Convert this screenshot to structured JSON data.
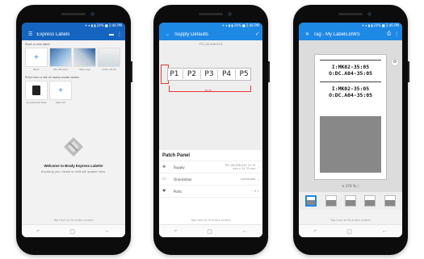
{
  "phones": [
    {
      "status": "✶ ▾ ▮ ▮ 24% ■ 2:46 PM",
      "title": "Express Labels",
      "start_label": "Start a new label",
      "tile_captions": [
        "Blank",
        "Pipe Markers",
        "Tape Lags",
        "Cable Labels"
      ],
      "print_label": "Print from a set of ready-made labels",
      "set_captions": [
        "Spreadsheet Data",
        "New Set"
      ],
      "welcome": "Welcome to Brady Express Labels!",
      "welcome_sub": "Anything you create or edit will appear here.",
      "hint": "Tap here to fit entire screen"
    },
    {
      "status": "✶ ▾ ▮ ▮ 24% ■ 2:46 PM",
      "title": "Supply Defaults",
      "canvas_title": "PTL-28-498-S1X",
      "ports": [
        "P1",
        "P2",
        "P3",
        "P4",
        "P5"
      ],
      "dimension": "81.28",
      "panel_title": "Patch Panel",
      "rows": [
        {
          "label": "Supply",
          "value": "PTL-28-498-S1X 12.70 mm x 12.70 mm"
        },
        {
          "label": "Orientation",
          "value": "Landscape"
        },
        {
          "label": "Ports",
          "value": "−  5  +"
        }
      ],
      "hint": "Tap here to fit entire screen"
    },
    {
      "status": "✶ ▾ ▮ ▮ 24% ■ 2:46 PM",
      "title": "Tag - My Labels.BWS",
      "label_lines": [
        [
          "I:MK02-35:05",
          "O:DC.A04-35:05"
        ],
        [
          "I:MK02-35:05",
          "O:DC.A04-35:05"
        ]
      ],
      "zoom": "174 %",
      "hint": "Tap here to fit entire screen"
    }
  ],
  "colors": {
    "primary": "#1e88e5",
    "appbar_dark": "#1565c0",
    "accent_red": "#e53935"
  }
}
